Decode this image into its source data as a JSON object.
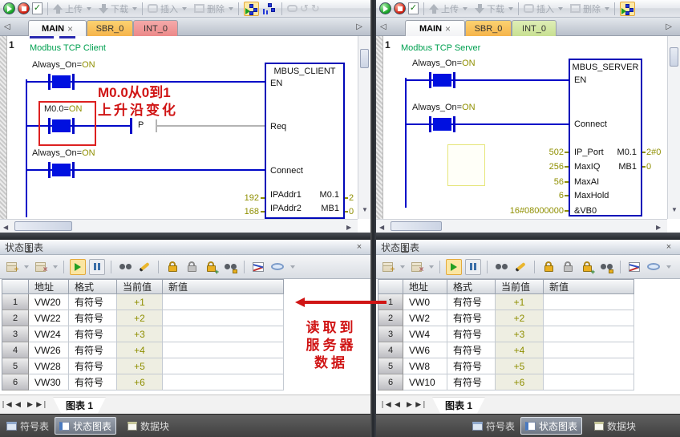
{
  "colors": {
    "wire_blue": "#0008c8",
    "energized_fill": "#0010e0",
    "value_olive": "#8f8f00",
    "network_title_green": "#00a050",
    "annotation_red": "#d01515",
    "tab_sbr_orange": "#f5b44b",
    "tab_int_pink": "#ec8989",
    "tab_int_green": "#c8e092",
    "cur_col_bg": "#eeeee2"
  },
  "left": {
    "toolbar": {
      "upload": "上传",
      "download": "下载",
      "insert": "插入",
      "del": "删除"
    },
    "tabs": {
      "main": "MAIN",
      "close": "×",
      "sbr0": "SBR_0",
      "int0": "INT_0"
    },
    "ladder": {
      "network_number": "1",
      "title": "Modbus TCP Client",
      "rung1_contact": "Always_On=",
      "rung1_state": "ON",
      "rung2_contact": "M0.0=",
      "rung2_state": "ON",
      "rung3_contact": "Always_On=",
      "rung3_state": "ON",
      "edge": "P",
      "annotation1": "M0.0从0到1",
      "annotation2": "上升沿变化",
      "block_title": "MBUS_CLIENT",
      "in_en": "EN",
      "in_req": "Req",
      "in_connect": "Connect",
      "in_ipaddr1": "IPAddr1",
      "in_ipaddr2": "IPAddr2",
      "val_ipaddr1": "192",
      "val_ipaddr2": "168",
      "out1": "M0.1",
      "out2": "MB1",
      "outval1": "2",
      "outval2": "0"
    },
    "chart": {
      "panel_title": "状态图表",
      "col_addr": "地址",
      "col_fmt": "格式",
      "col_cur": "当前值",
      "col_new": "新值",
      "rows": [
        {
          "n": "1",
          "addr": "VW20",
          "fmt": "有符号",
          "cur": "+1",
          "new": ""
        },
        {
          "n": "2",
          "addr": "VW22",
          "fmt": "有符号",
          "cur": "+2",
          "new": ""
        },
        {
          "n": "3",
          "addr": "VW24",
          "fmt": "有符号",
          "cur": "+3",
          "new": ""
        },
        {
          "n": "4",
          "addr": "VW26",
          "fmt": "有符号",
          "cur": "+4",
          "new": ""
        },
        {
          "n": "5",
          "addr": "VW28",
          "fmt": "有符号",
          "cur": "+5",
          "new": ""
        },
        {
          "n": "6",
          "addr": "VW30",
          "fmt": "有符号",
          "cur": "+6",
          "new": ""
        }
      ],
      "sheet_tab": "图表 1"
    },
    "statusbar": {
      "symbols": "符号表",
      "chart": "状态图表",
      "datablock": "数据块"
    }
  },
  "right": {
    "toolbar": {
      "upload": "上传",
      "download": "下载",
      "insert": "插入",
      "del": "删除"
    },
    "tabs": {
      "main": "MAIN",
      "close": "×",
      "sbr0": "SBR_0",
      "int0": "INT_0"
    },
    "ladder": {
      "network_number": "1",
      "title": "Modbus TCP Server",
      "rung1_contact": "Always_On=",
      "rung1_state": "ON",
      "rung2_contact": "Always_On=",
      "rung2_state": "ON",
      "block_title": "MBUS_SERVER",
      "in_en": "EN",
      "in_connect": "Connect",
      "in_ipport": "IP_Port",
      "in_maxiq": "MaxIQ",
      "in_maxai": "MaxAI",
      "in_maxhold": "MaxHold",
      "in_vb0": "&VB0",
      "val_ipport": "502",
      "val_maxiq": "256",
      "val_maxai": "56",
      "val_maxhold": "6",
      "val_vb0": "16#08000000",
      "out1": "M0.1",
      "out2": "MB1",
      "outval1": "2#0",
      "outval2": "0"
    },
    "chart": {
      "panel_title": "状态图表",
      "col_addr": "地址",
      "col_fmt": "格式",
      "col_cur": "当前值",
      "col_new": "新值",
      "rows": [
        {
          "n": "1",
          "addr": "VW0",
          "fmt": "有符号",
          "cur": "+1",
          "new": ""
        },
        {
          "n": "2",
          "addr": "VW2",
          "fmt": "有符号",
          "cur": "+2",
          "new": ""
        },
        {
          "n": "3",
          "addr": "VW4",
          "fmt": "有符号",
          "cur": "+3",
          "new": ""
        },
        {
          "n": "4",
          "addr": "VW6",
          "fmt": "有符号",
          "cur": "+4",
          "new": ""
        },
        {
          "n": "5",
          "addr": "VW8",
          "fmt": "有符号",
          "cur": "+5",
          "new": ""
        },
        {
          "n": "6",
          "addr": "VW10",
          "fmt": "有符号",
          "cur": "+6",
          "new": ""
        }
      ],
      "sheet_tab": "图表 1"
    },
    "statusbar": {
      "symbols": "符号表",
      "chart": "状态图表",
      "datablock": "数据块"
    }
  },
  "note": {
    "line1": "读取到",
    "line2": "服务器",
    "line3": "数据"
  }
}
